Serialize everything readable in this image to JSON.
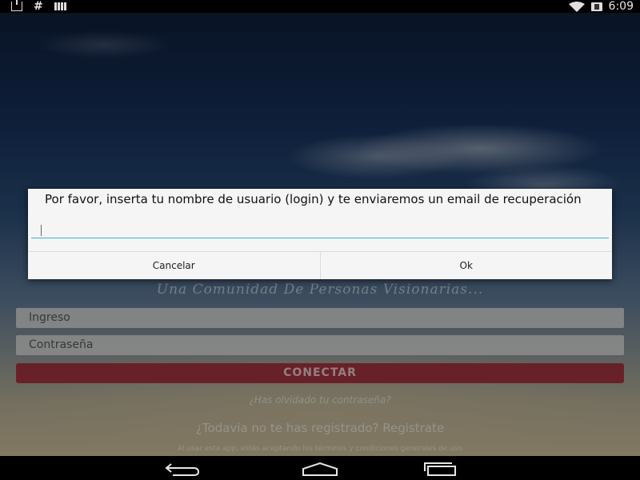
{
  "status_bar": {
    "time": "6:09",
    "left_icons": [
      "download-icon",
      "hash-icon",
      "signal-bars-icon"
    ],
    "right_icons": [
      "wifi-icon",
      "battery-icon"
    ]
  },
  "login": {
    "tagline": "Una Comunidad De Personas Visionarias...",
    "username_placeholder": "Ingreso",
    "password_placeholder": "Contraseña",
    "connect_label": "CONECTAR",
    "forgot_label": "¿Has olvidado tu contraseña?",
    "register_label": "¿Todavia no te has registrado? Registrate",
    "terms_text": "Al usar esta app, estás aceptando los términos y condiciones generales de uso"
  },
  "dialog": {
    "message": "Por favor, inserta tu nombre de usuario (login) y te enviaremos un email de recuperación",
    "input_value": "",
    "cancel_label": "Cancelar",
    "ok_label": "Ok"
  },
  "nav_bar": {
    "icons": [
      "back-icon",
      "home-icon",
      "recent-apps-icon"
    ]
  },
  "colors": {
    "connect_button": "#a0343f",
    "dialog_background": "#f5f5f5",
    "input_underline": "#33b5e5"
  }
}
